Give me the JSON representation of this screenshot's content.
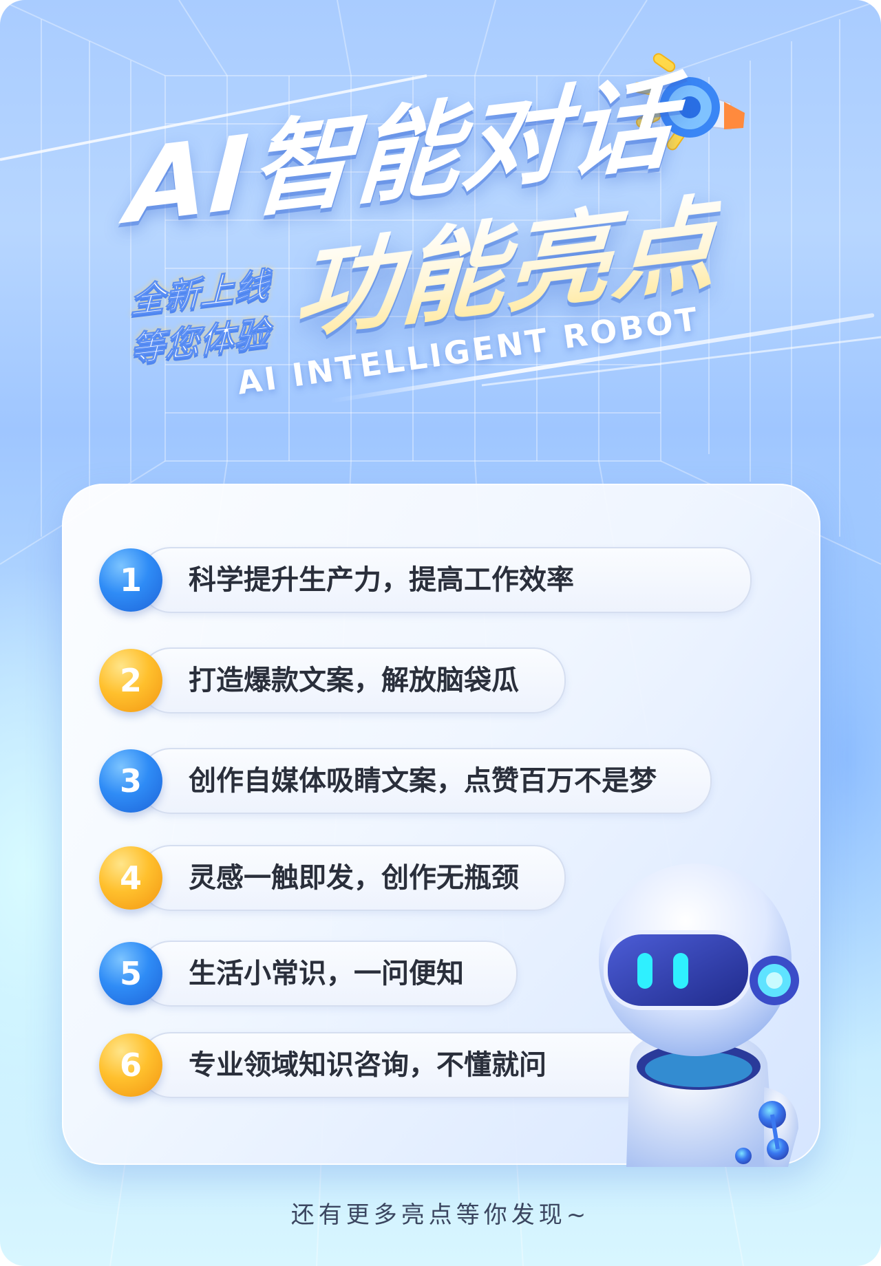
{
  "title": {
    "line1": "AI智能对话",
    "line2": "功能亮点",
    "subtitle_line1": "全新上线",
    "subtitle_line2": "等您体验",
    "english": "AI INTELLIGENT ROBOT"
  },
  "features": [
    {
      "number": "1",
      "text": "科学提升生产力，提高工作效率",
      "color": "blue"
    },
    {
      "number": "2",
      "text": "打造爆款文案，解放脑袋瓜",
      "color": "gold"
    },
    {
      "number": "3",
      "text": "创作自媒体吸睛文案，点赞百万不是梦",
      "color": "blue"
    },
    {
      "number": "4",
      "text": "灵感一触即发，创作无瓶颈",
      "color": "gold"
    },
    {
      "number": "5",
      "text": "生活小常识，一问便知",
      "color": "blue"
    },
    {
      "number": "6",
      "text": "专业领域知识咨询，不懂就问",
      "color": "gold"
    }
  ],
  "footer": "还有更多亮点等你发现~",
  "icons": {
    "megaphone": "megaphone-icon",
    "robot": "robot-illustration"
  },
  "colors": {
    "accent_blue": "#2f8cf6",
    "accent_gold": "#ffc02d",
    "background": "#a9ccff"
  }
}
